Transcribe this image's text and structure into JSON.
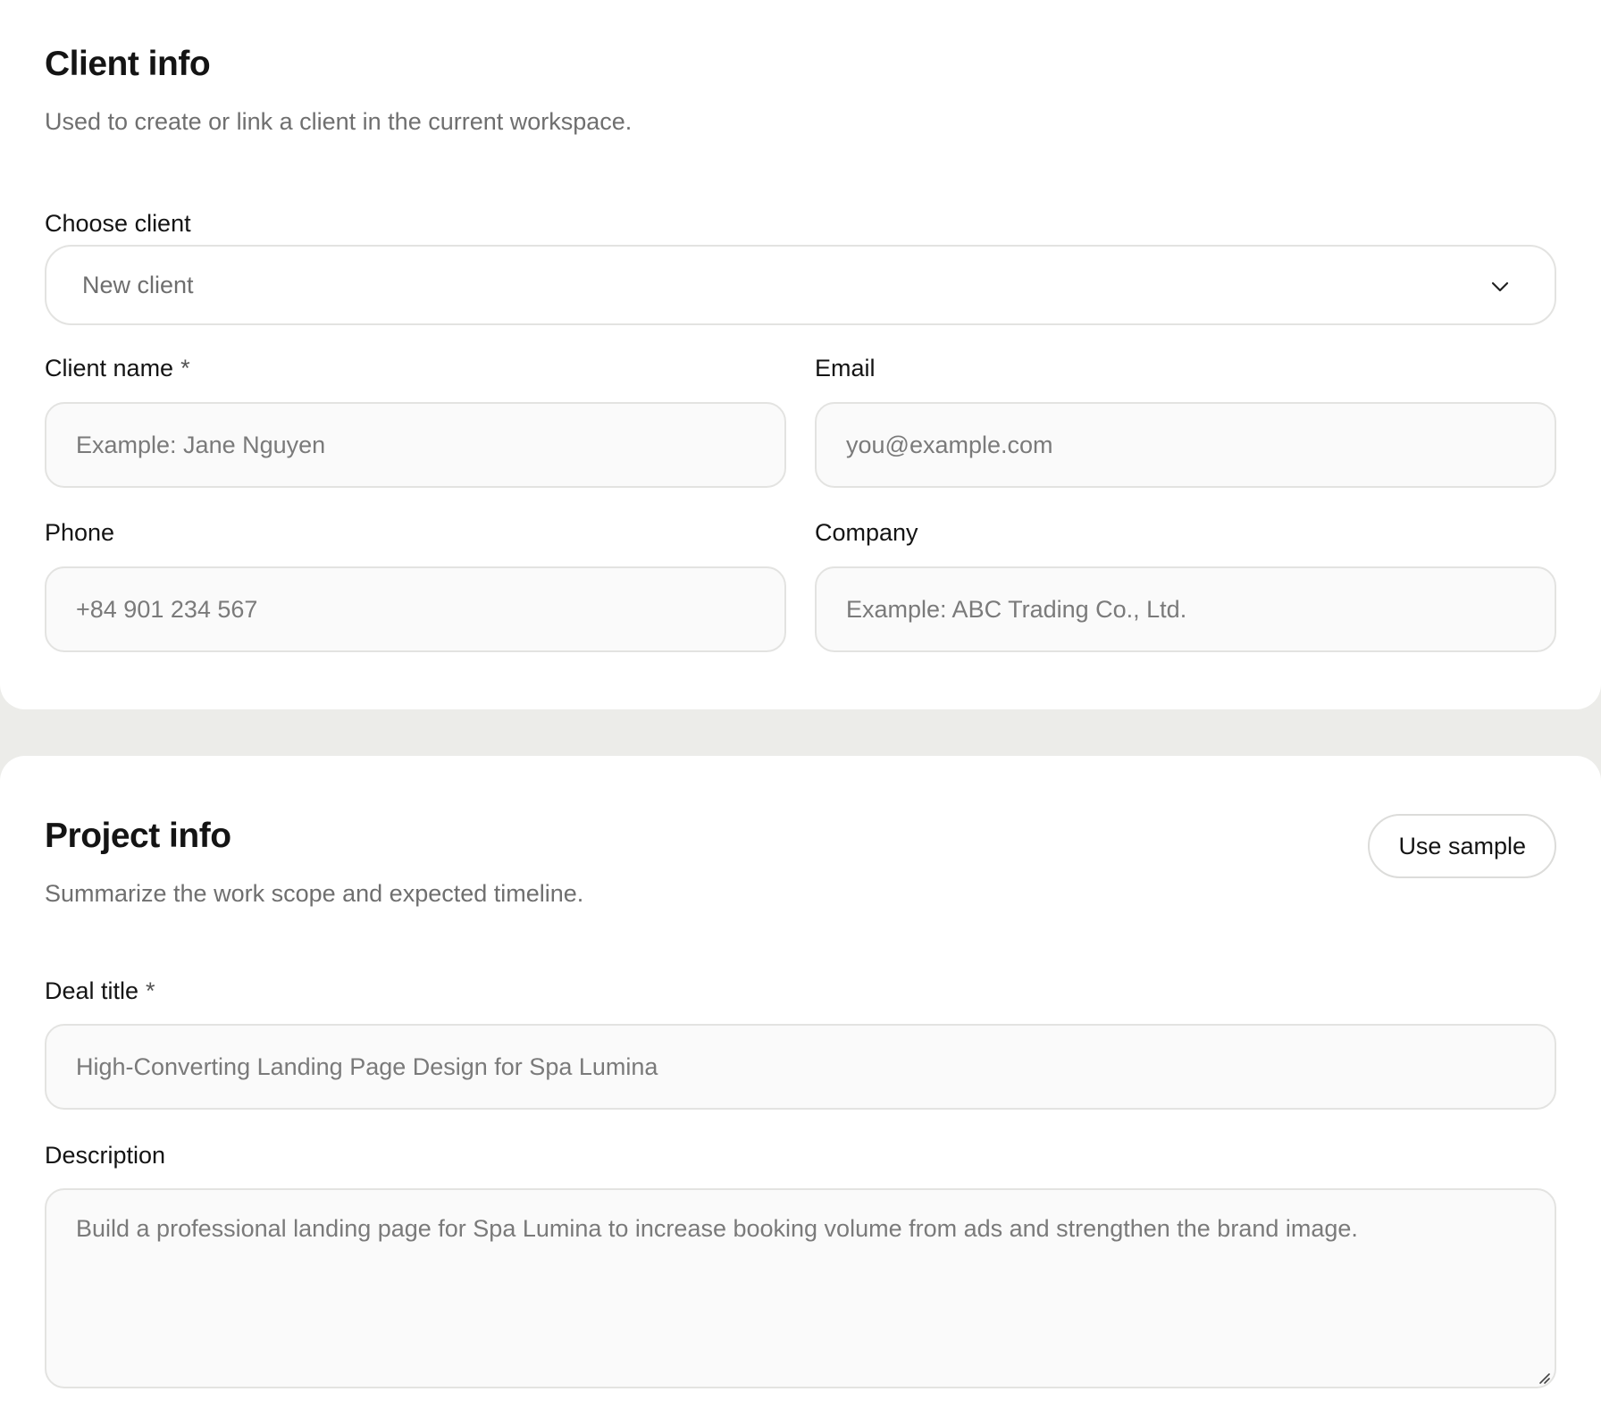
{
  "client_section": {
    "title": "Client info",
    "subtitle": "Used to create or link a client in the current workspace.",
    "choose_client": {
      "label": "Choose client",
      "selected": "New client",
      "icon": "chevron-down-icon"
    },
    "client_name": {
      "label": "Client name",
      "required_mark": "*",
      "placeholder": "Example: Jane Nguyen",
      "value": ""
    },
    "email": {
      "label": "Email",
      "placeholder": "you@example.com",
      "value": ""
    },
    "phone": {
      "label": "Phone",
      "placeholder": "+84 901 234 567",
      "value": ""
    },
    "company": {
      "label": "Company",
      "placeholder": "Example: ABC Trading Co., Ltd.",
      "value": ""
    }
  },
  "project_section": {
    "title": "Project info",
    "subtitle": "Summarize the work scope and expected timeline.",
    "use_sample_label": "Use sample",
    "deal_title": {
      "label": "Deal title",
      "required_mark": "*",
      "placeholder": "High-Converting Landing Page Design for Spa Lumina",
      "value": ""
    },
    "description": {
      "label": "Description",
      "placeholder": "Build a professional landing page for Spa Lumina to increase booking volume from ads and strengthen the brand image.",
      "value": ""
    }
  },
  "colors": {
    "page_bg": "#ecece9",
    "card_bg": "#ffffff",
    "input_bg": "#fafafa",
    "border": "#e3e3e1",
    "text_primary": "#141414",
    "text_muted": "#6f6f6f"
  }
}
